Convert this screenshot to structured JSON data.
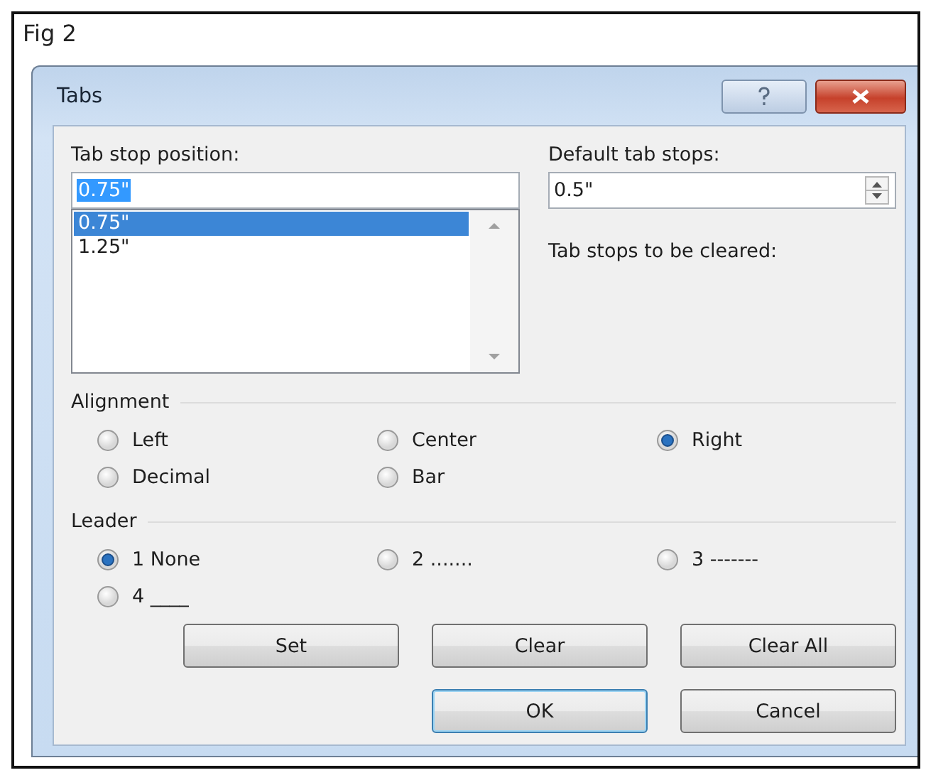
{
  "figure": {
    "caption": "Fig 2"
  },
  "dialog": {
    "title": "Tabs",
    "tab_stop_position": {
      "label": "Tab stop position:",
      "value": "0.75\"",
      "value_selected": true
    },
    "tab_stops": [
      {
        "text": "0.75\"",
        "selected": true
      },
      {
        "text": "1.25\"",
        "selected": false
      }
    ],
    "default_tab_stops": {
      "label": "Default tab stops:",
      "value": "0.5\""
    },
    "to_be_cleared": {
      "label": "Tab stops to be cleared:"
    },
    "alignment": {
      "label": "Alignment",
      "options": [
        {
          "label": "Left",
          "selected": false
        },
        {
          "label": "Center",
          "selected": false
        },
        {
          "label": "Right",
          "selected": true
        },
        {
          "label": "Decimal",
          "selected": false
        },
        {
          "label": "Bar",
          "selected": false
        }
      ]
    },
    "leader": {
      "label": "Leader",
      "options": [
        {
          "label": "1 None",
          "selected": true
        },
        {
          "label": "2 .......",
          "selected": false
        },
        {
          "label": "3 -------",
          "selected": false
        },
        {
          "label": "4 ____",
          "selected": false
        }
      ]
    },
    "action_buttons": [
      {
        "label": "Set"
      },
      {
        "label": "Clear"
      },
      {
        "label": "Clear All"
      }
    ],
    "dialog_buttons": [
      {
        "label": "OK",
        "default": true
      },
      {
        "label": "Cancel",
        "default": false
      }
    ]
  }
}
